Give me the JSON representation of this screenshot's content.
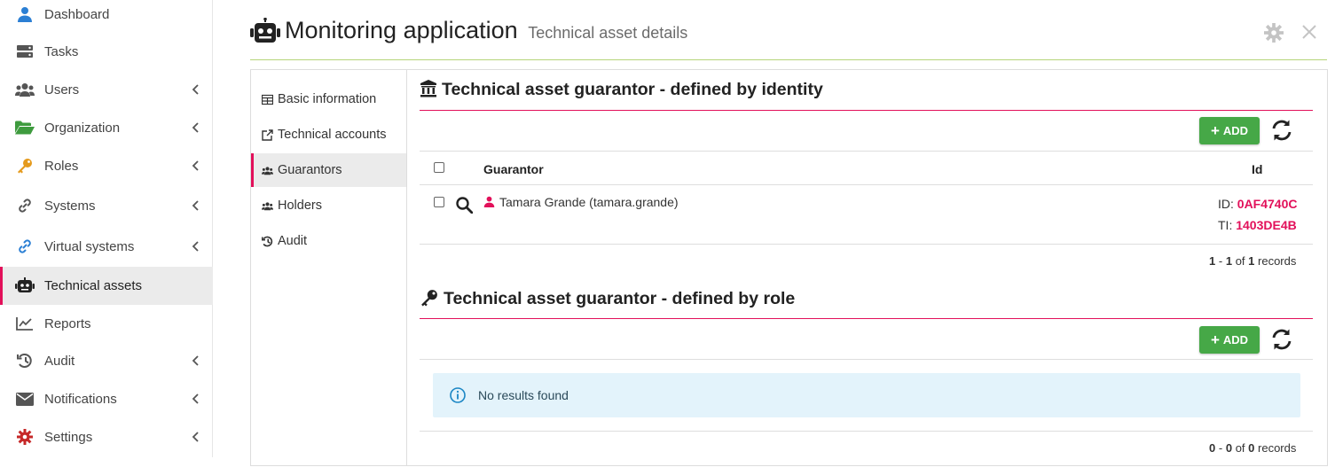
{
  "sidebar": {
    "items": [
      {
        "label": "Dashboard",
        "icon": "user-icon",
        "color": "#2b7fd4"
      },
      {
        "label": "Tasks",
        "icon": "tasks-icon",
        "color": "#555555"
      },
      {
        "label": "Users",
        "icon": "users-icon",
        "color": "#555555"
      },
      {
        "label": "Organization",
        "icon": "folder-open-icon",
        "color": "#3e9b3e"
      },
      {
        "label": "Roles",
        "icon": "key-icon",
        "color": "#e59a1c"
      },
      {
        "label": "Systems",
        "icon": "link-icon",
        "color": "#555555"
      },
      {
        "label": "Virtual systems",
        "icon": "link-icon",
        "color": "#2b7fd4"
      },
      {
        "label": "Technical assets",
        "icon": "robot-icon",
        "color": "#222222"
      },
      {
        "label": "Reports",
        "icon": "chart-line-icon",
        "color": "#555555"
      },
      {
        "label": "Audit",
        "icon": "history-icon",
        "color": "#555555"
      },
      {
        "label": "Notifications",
        "icon": "envelope-icon",
        "color": "#555555"
      },
      {
        "label": "Settings",
        "icon": "gear-icon",
        "color": "#c62828"
      }
    ]
  },
  "header": {
    "title": "Monitoring application",
    "subtitle": "Technical asset details"
  },
  "subnav": {
    "items": [
      {
        "label": "Basic information"
      },
      {
        "label": "Technical accounts"
      },
      {
        "label": "Guarantors"
      },
      {
        "label": "Holders"
      },
      {
        "label": "Audit"
      }
    ]
  },
  "identity_section": {
    "title": "Technical asset guarantor - defined by identity",
    "add_label": "ADD",
    "columns": {
      "guarantor": "Guarantor",
      "id": "Id"
    },
    "rows": [
      {
        "guarantor": "Tamara Grande (tamara.grande)",
        "id_prefix": "ID:",
        "id_value": "0AF4740C",
        "ti_prefix": "TI:",
        "ti_value": "1403DE4B"
      }
    ],
    "records": {
      "from": "1",
      "dash": "-",
      "to": "1",
      "of": "of",
      "total": "1",
      "word": "records"
    }
  },
  "role_section": {
    "title": "Technical asset guarantor - defined by role",
    "add_label": "ADD",
    "empty_message": "No results found",
    "records": {
      "from": "0",
      "dash": "-",
      "to": "0",
      "of": "of",
      "total": "0",
      "word": "records"
    }
  },
  "colors": {
    "accent": "#e2105a",
    "success": "#46a847",
    "header_line": "#b5d47a",
    "info_bg": "#e3f3fb"
  }
}
